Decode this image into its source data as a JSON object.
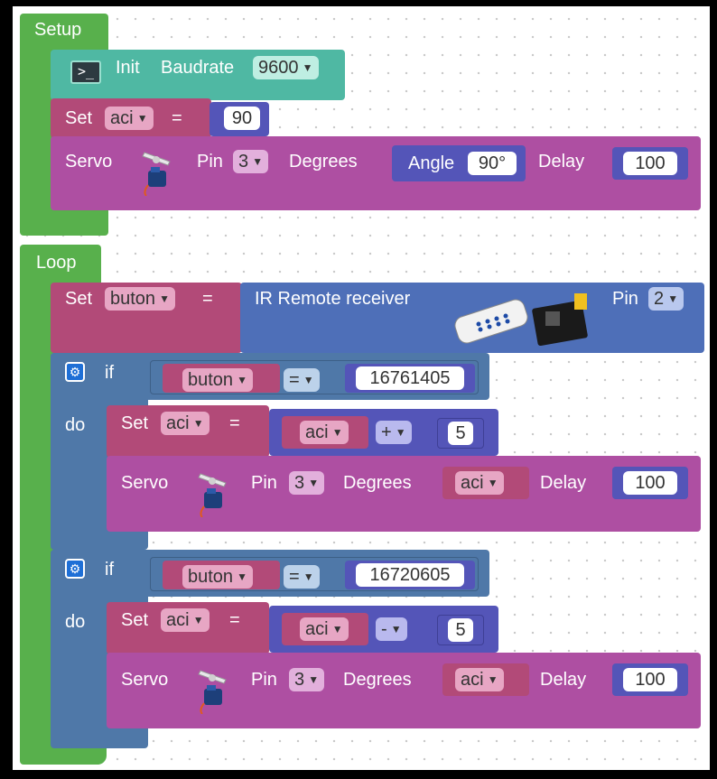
{
  "setup": {
    "label": "Setup",
    "init": {
      "label": "Init",
      "baud_label": "Baudrate",
      "baud_value": "9600"
    },
    "set_aci": {
      "set": "Set",
      "var": "aci",
      "eq": "=",
      "value": "90"
    },
    "servo": {
      "label": "Servo",
      "pin_label": "Pin",
      "pin": "3",
      "deg_label": "Degrees",
      "angle_label": "Angle",
      "angle": "90°",
      "delay_label": "Delay",
      "delay": "100"
    }
  },
  "loop": {
    "label": "Loop",
    "set_buton": {
      "set": "Set",
      "var": "buton",
      "eq": "=",
      "sensor": "IR Remote receiver",
      "pin_label": "Pin",
      "pin": "2"
    },
    "if1": {
      "if": "if",
      "do": "do",
      "var": "buton",
      "op": "=",
      "value": "16761405",
      "set": {
        "set": "Set",
        "var": "aci",
        "eq": "=",
        "a": "aci",
        "op": "+",
        "b": "5"
      },
      "servo": {
        "label": "Servo",
        "pin_label": "Pin",
        "pin": "3",
        "deg_label": "Degrees",
        "deg": "aci",
        "delay_label": "Delay",
        "delay": "100"
      }
    },
    "if2": {
      "if": "if",
      "do": "do",
      "var": "buton",
      "op": "=",
      "value": "16720605",
      "set": {
        "set": "Set",
        "var": "aci",
        "eq": "=",
        "a": "aci",
        "op": "-",
        "b": "5"
      },
      "servo": {
        "label": "Servo",
        "pin_label": "Pin",
        "pin": "3",
        "deg_label": "Degrees",
        "deg": "aci",
        "delay_label": "Delay",
        "delay": "100"
      }
    }
  },
  "colors": {
    "setup": "#58b04c",
    "serial": "#4fb8a3",
    "variable": "#b24a78",
    "servo": "#ae4fa2",
    "logic": "#4f78a8",
    "math": "#5455b8",
    "ir": "#4e6fb8"
  },
  "icons": [
    "terminal-icon",
    "servo-motor-icon",
    "ir-remote-icon",
    "gear-icon"
  ]
}
